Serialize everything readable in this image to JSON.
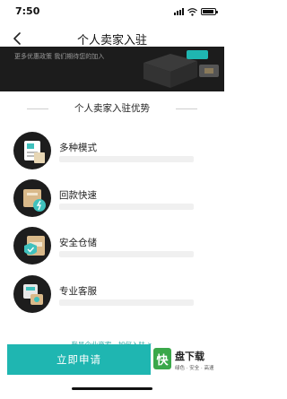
{
  "status_bar": {
    "time": "7:50",
    "icons": [
      "signal-icon",
      "wifi-icon",
      "battery-icon"
    ],
    "battery_level": 0.9
  },
  "nav": {
    "title": "个人卖家入驻",
    "back_icon": "chevron-left-icon"
  },
  "banner": {
    "text": "更多优惠政策 我们期待您的加入"
  },
  "advantages": {
    "title": "个人卖家入驻优势",
    "items": [
      {
        "label": "多种模式",
        "icon": "multi-mode-icon"
      },
      {
        "label": "回款快速",
        "icon": "fast-payment-icon"
      },
      {
        "label": "安全仓储",
        "icon": "secure-warehouse-icon"
      },
      {
        "label": "专业客服",
        "icon": "customer-service-icon"
      }
    ]
  },
  "corporate_link": "我是企业商家，如何入驻 >",
  "apply_button": "立即申请",
  "watermark": {
    "logo": "快",
    "title": "盘下载",
    "subtitle": "绿色 · 安全 · 高速"
  },
  "colors": {
    "accent": "#1fb6b1",
    "banner_bg": "#1c1c1c",
    "link": "#2aa7a4"
  }
}
